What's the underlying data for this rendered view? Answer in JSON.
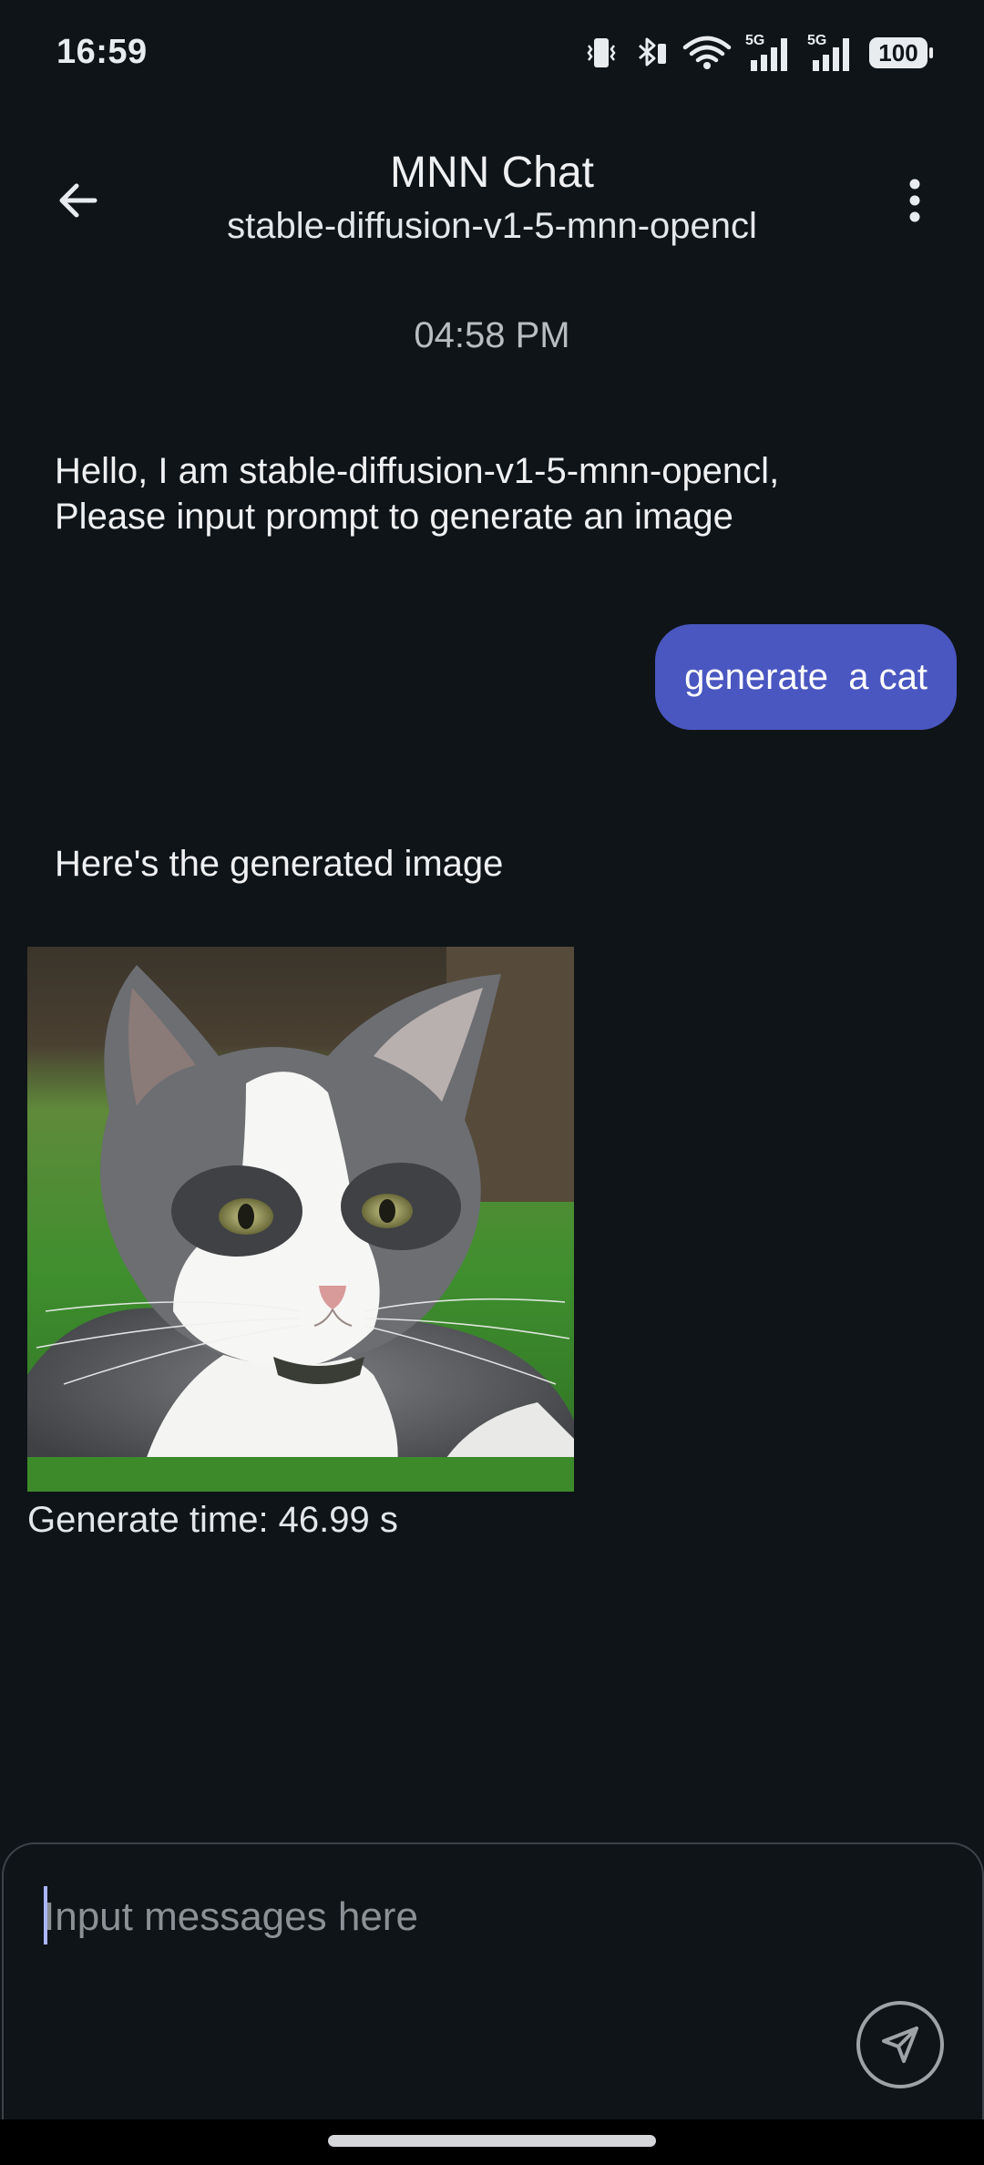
{
  "status_bar": {
    "time": "16:59",
    "battery": "100",
    "network_1": "5G",
    "network_2": "5G",
    "icons": [
      "vibrate-icon",
      "bluetooth-icon",
      "wifi-icon",
      "signal-5g-icon",
      "signal-5g-icon",
      "battery-icon"
    ]
  },
  "app_bar": {
    "title": "MNN Chat",
    "subtitle": "stable-diffusion-v1-5-mnn-opencl",
    "back_icon": "arrow-back-icon",
    "menu_icon": "more-vert-icon"
  },
  "chat": {
    "timestamp": "04:58 PM",
    "bot_greeting_lines": [
      "Hello, I am stable-diffusion-v1-5-mnn-opencl,",
      "Please input prompt to generate an image"
    ],
    "user_message": "generate  a cat",
    "bot_caption": "Here's the generated image",
    "generate_time": "Generate time: 46.99 s"
  },
  "composer": {
    "placeholder": "Input messages here",
    "value": "",
    "send_icon": "send-icon"
  },
  "colors": {
    "background": "#0f1418",
    "user_bubble": "#4a57c1",
    "text": "#eef0f2",
    "muted": "#8c9196"
  }
}
